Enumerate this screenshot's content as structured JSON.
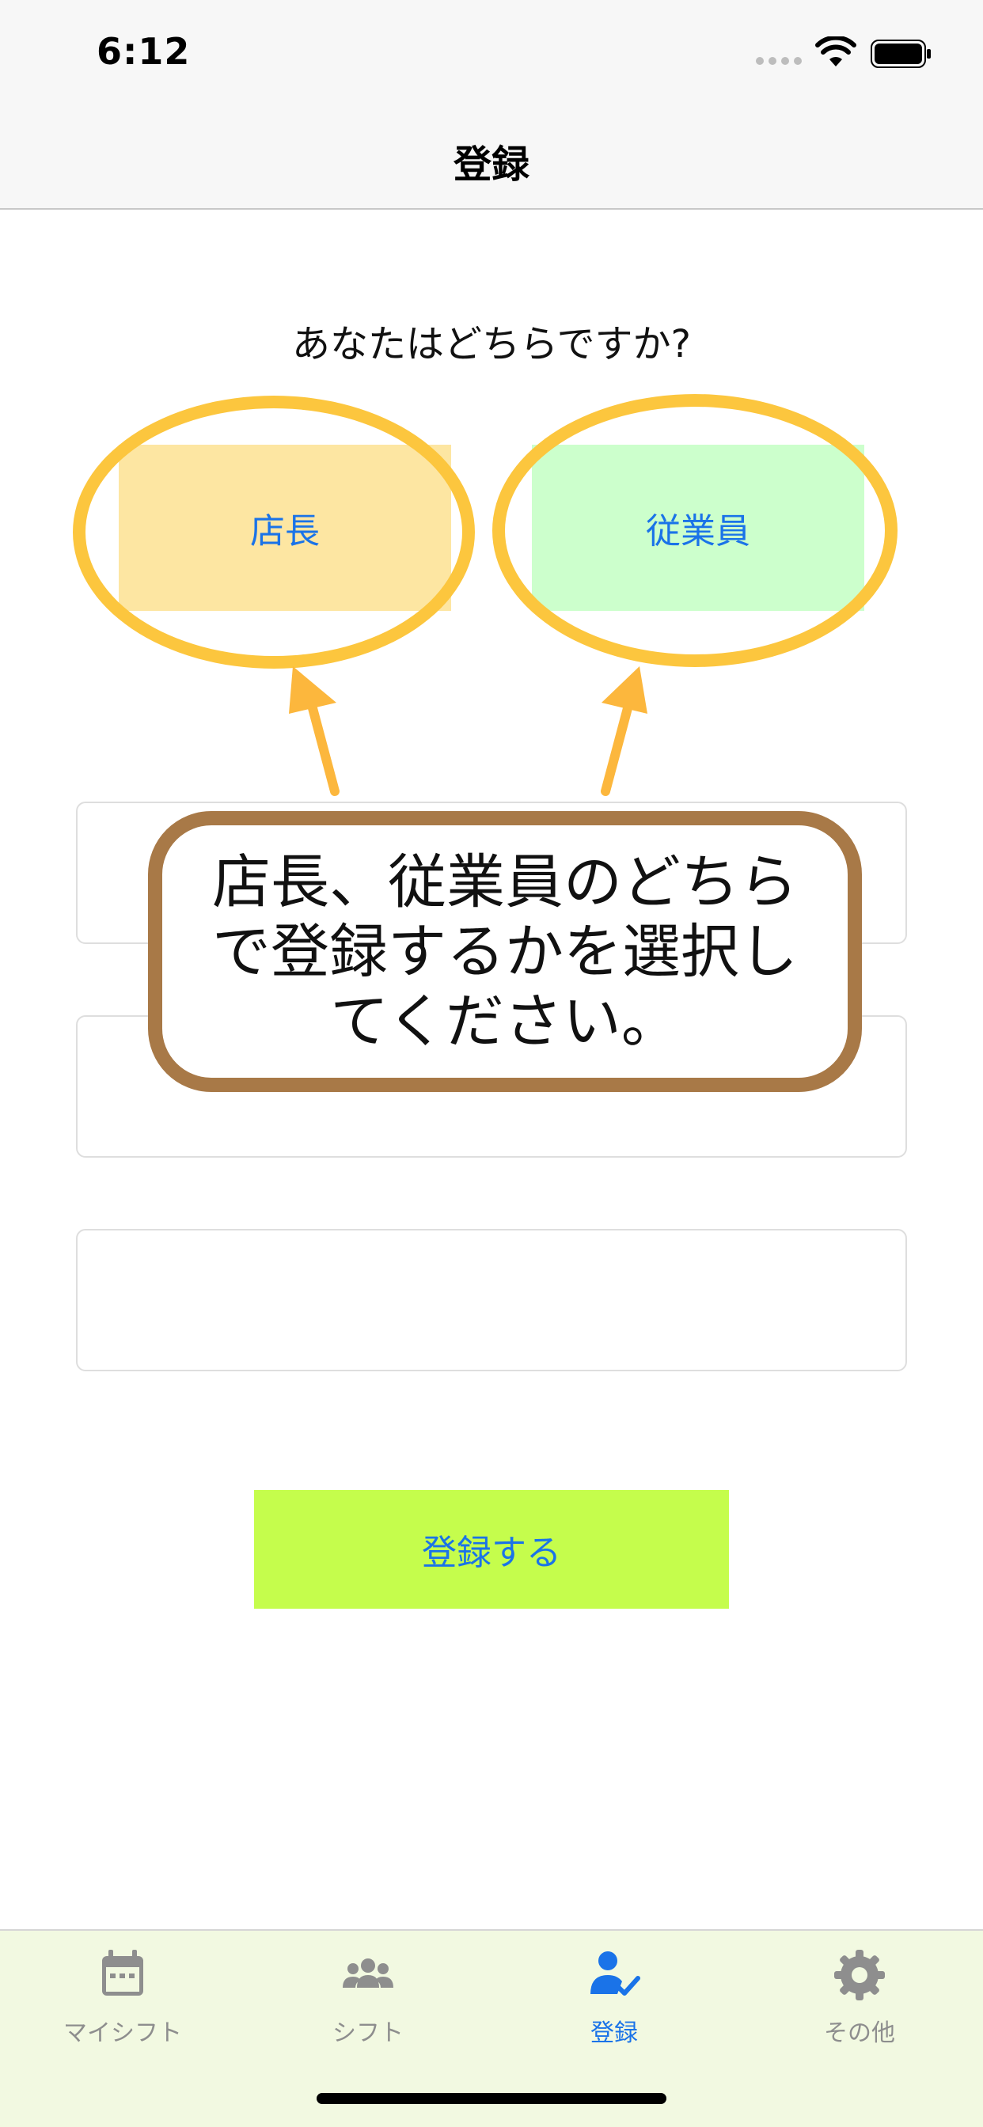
{
  "status_bar": {
    "time": "6:12"
  },
  "nav": {
    "title": "登録"
  },
  "question": "あなたはどちらですか?",
  "roles": {
    "manager": "店長",
    "employee": "従業員"
  },
  "callout": {
    "lines": [
      "店長、従業員のどちら",
      "で登録するかを選択し",
      "てください。"
    ]
  },
  "form": {
    "field_1": "",
    "field_2": "",
    "field_3": ""
  },
  "submit_label": "登録する",
  "tabs": [
    {
      "label": "マイシフト",
      "icon": "calendar-icon"
    },
    {
      "label": "シフト",
      "icon": "group-icon"
    },
    {
      "label": "登録",
      "icon": "person-check-icon",
      "active": true
    },
    {
      "label": "その他",
      "icon": "gear-icon"
    }
  ],
  "colors": {
    "accent": "#1a73e8",
    "manager_button": "#fde6a2",
    "employee_button": "#ccffcc",
    "submit_button": "#c5fd4c",
    "highlight_ring": "#fcc63e",
    "callout_border": "#a87947",
    "tab_bar": "#f2f9e1"
  }
}
